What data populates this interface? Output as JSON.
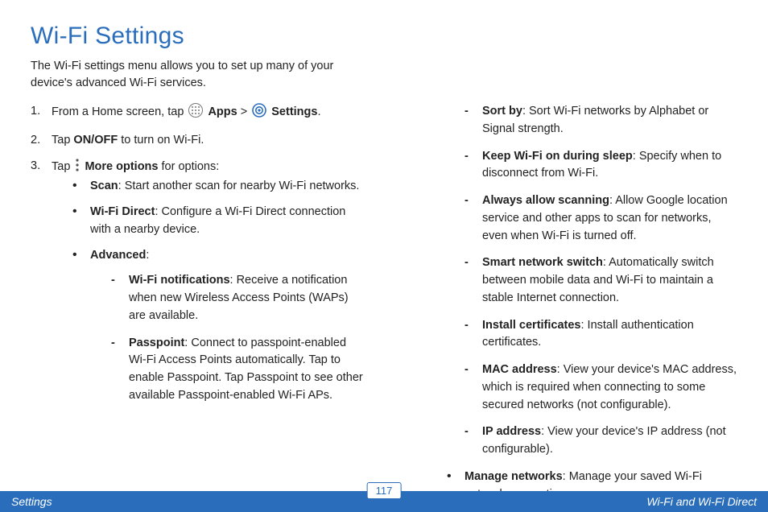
{
  "title": "Wi-Fi Settings",
  "intro": "The Wi-Fi settings menu allows you to set up many of your device's advanced Wi-Fi services.",
  "step1_a": "From a Home screen, tap ",
  "step1_apps": "Apps",
  "step1_gt": " > ",
  "step1_settings": "Settings",
  "step1_end": ".",
  "step2_a": "Tap ",
  "step2_b": "ON/OFF",
  "step2_c": " to turn on Wi-Fi.",
  "step3_a": "Tap ",
  "step3_b": "More options",
  "step3_c": " for options:",
  "opt_scan_t": "Scan",
  "opt_scan_d": ": Start another scan for nearby Wi-Fi networks.",
  "opt_wfd_t": "Wi-Fi Direct",
  "opt_wfd_d": ": Configure a Wi-Fi Direct connection with a nearby device.",
  "opt_adv_t": "Advanced",
  "adv_notif_t": "Wi-Fi notifications",
  "adv_notif_d": ": Receive a notification when new Wireless Access Points (WAPs) are available.",
  "adv_pass_t": "Passpoint",
  "adv_pass_d": ": Connect to passpoint-enabled Wi-Fi Access Points automatically. Tap to enable Passpoint. Tap Passpoint to see other available Passpoint-enabled Wi-Fi APs.",
  "adv_sort_t": "Sort by",
  "adv_sort_d": ": Sort Wi-Fi networks by Alphabet or Signal strength.",
  "adv_keep_t": "Keep Wi-Fi on during sleep",
  "adv_keep_d": ": Specify when to disconnect from Wi-Fi.",
  "adv_scan_t": "Always allow scanning",
  "adv_scan_d": ": Allow Google location service and other apps to scan for networks, even when Wi-Fi is turned off.",
  "adv_smart_t": "Smart network switch",
  "adv_smart_d": ": Automatically switch between mobile data and Wi-Fi to maintain a stable Internet connection.",
  "adv_cert_t": "Install certificates",
  "adv_cert_d": ": Install authentication certificates.",
  "adv_mac_t": "MAC address",
  "adv_mac_d": ": View your device's MAC address, which is required when connecting to some secured networks (not configurable).",
  "adv_ip_t": "IP address",
  "adv_ip_d": ": View your device's IP address (not configurable).",
  "opt_mng_t": "Manage networks",
  "opt_mng_d": ": Manage your saved Wi-Fi network connections.",
  "footer_left": "Settings",
  "footer_page": "117",
  "footer_right": "Wi-Fi and Wi-Fi Direct"
}
